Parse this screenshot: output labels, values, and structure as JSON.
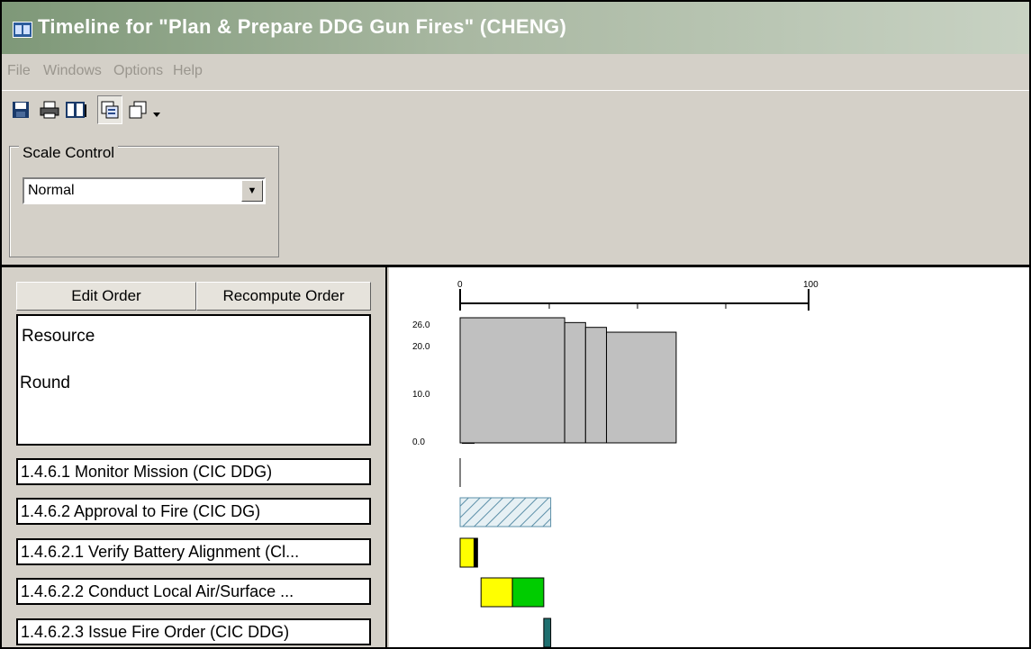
{
  "window": {
    "title": "Timeline for \"Plan & Prepare DDG Gun Fires\" (CHENG)"
  },
  "menu": [
    "File",
    "Windows",
    "Options",
    "Help"
  ],
  "toolbar": {
    "buttons": [
      {
        "icon": "save-icon"
      },
      {
        "icon": "print-icon"
      },
      {
        "icon": "print-preview-icon"
      },
      {
        "icon": "view-mode-1-icon"
      },
      {
        "icon": "view-mode-2-icon"
      },
      {
        "icon": "dropdown-arrow-icon"
      }
    ]
  },
  "scale_control": {
    "label": "Scale Control",
    "value": "Normal"
  },
  "buttons": {
    "edit_order": "Edit Order",
    "recompute_order": "Recompute Order"
  },
  "resource_panel": {
    "line1": "Resource",
    "line2": "Round"
  },
  "tasks": [
    "1.4.6.1 Monitor Mission (CIC DDG)",
    "1.4.6.2 Approval to Fire (CIC DG)",
    "1.4.6.2.1 Verify Battery Alignment (Cl...",
    "1.4.6.2.2 Conduct Local Air/Surface ...",
    "1.4.6.2.3 Issue Fire Order (CIC DDG)"
  ],
  "timeline": {
    "axis_ticks": [
      "0",
      "100"
    ],
    "y_ticks": [
      "26.0",
      "20.0",
      "10.0",
      "0.0"
    ],
    "colors": {
      "hatch": "#5b8fa8",
      "yellow": "#ffff00",
      "green": "#00cc00",
      "teal": "#1f6f6f",
      "bar_fill": "#c0c0c0"
    }
  },
  "chart_data": {
    "type": "bar",
    "title": "",
    "xlabel": "",
    "ylabel": "",
    "x_range": [
      0,
      100
    ],
    "ylim": [
      0,
      26
    ],
    "resource_steps": [
      {
        "x_start": 0,
        "x_end": 30,
        "value": 26.0
      },
      {
        "x_start": 30,
        "x_end": 36,
        "value": 25.0
      },
      {
        "x_start": 36,
        "x_end": 42,
        "value": 24.0
      },
      {
        "x_start": 42,
        "x_end": 62,
        "value": 23.0
      }
    ],
    "tasks": [
      {
        "name": "1.4.6.1 Monitor Mission (CIC DDG)",
        "start": 0,
        "end": 0,
        "style": "line"
      },
      {
        "name": "1.4.6.2 Approval to Fire (CIC DG)",
        "start": 0,
        "end": 26,
        "style": "hatch"
      },
      {
        "name": "1.4.6.2.1 Verify Battery Alignment (Cl...",
        "segments": [
          {
            "start": 0,
            "end": 4,
            "color": "yellow"
          },
          {
            "start": 4,
            "end": 5,
            "color": "black"
          }
        ]
      },
      {
        "name": "1.4.6.2.2 Conduct Local Air/Surface ...",
        "segments": [
          {
            "start": 6,
            "end": 15,
            "color": "yellow"
          },
          {
            "start": 15,
            "end": 24,
            "color": "green"
          }
        ]
      },
      {
        "name": "1.4.6.2.3 Issue Fire Order (CIC DDG)",
        "segments": [
          {
            "start": 24,
            "end": 26,
            "color": "teal"
          }
        ]
      }
    ]
  }
}
